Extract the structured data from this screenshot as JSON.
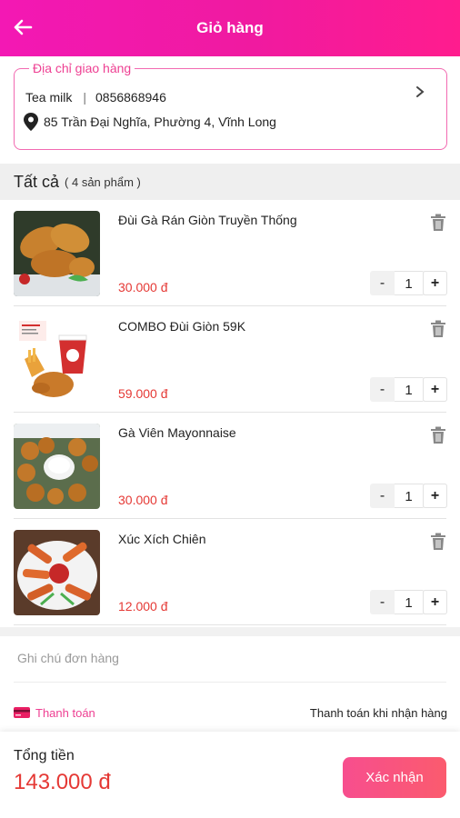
{
  "header": {
    "title": "Giỏ hàng",
    "back_icon": "arrow-left-icon"
  },
  "address": {
    "legend": "Địa chỉ giao hàng",
    "name": "Tea milk",
    "separator": "|",
    "phone": "0856868946",
    "street": "85 Trần Đại Nghĩa, Phường 4, Vĩnh Long"
  },
  "section": {
    "all_label": "Tất cả",
    "count_label": "( 4 sản phẩm )"
  },
  "items": [
    {
      "name": "Đùi Gà Rán Giòn Truyền Thống",
      "price": "30.000 đ",
      "qty": "1"
    },
    {
      "name": "COMBO Đùi Giòn 59K",
      "price": "59.000 đ",
      "qty": "1"
    },
    {
      "name": "Gà Viên Mayonnaise",
      "price": "30.000 đ",
      "qty": "1"
    },
    {
      "name": "Xúc Xích Chiên",
      "price": "12.000 đ",
      "qty": "1"
    }
  ],
  "qty_controls": {
    "minus": "-",
    "plus": "+"
  },
  "note": {
    "placeholder": "Ghi chú đơn hàng"
  },
  "payment": {
    "label": "Thanh toán",
    "method": "Thanh toán khi nhận hàng"
  },
  "footer": {
    "total_label": "Tổng tiền",
    "total_value": "143.000 đ",
    "confirm_label": "Xác nhận"
  },
  "colors": {
    "accent": "#f01aa0",
    "price": "#e53935",
    "button": "#f74e8e"
  }
}
